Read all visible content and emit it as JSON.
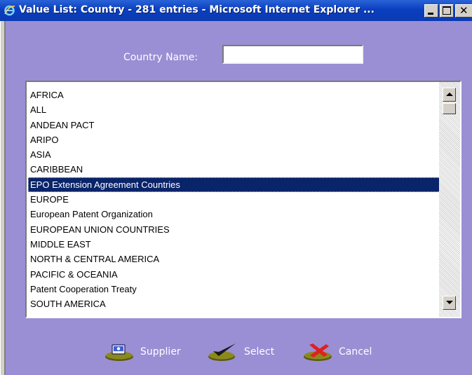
{
  "window": {
    "title": "Value List: Country - 281 entries - Microsoft Internet Explorer ...",
    "icon": "ie-icon",
    "controls": [
      "minimize-icon",
      "maximize-icon",
      "close-icon"
    ],
    "close_glyph": "✕"
  },
  "search": {
    "label": "Country Name:",
    "value": ""
  },
  "list": {
    "selected_index": 6,
    "items": [
      "AFRICA",
      "ALL",
      "ANDEAN PACT",
      "ARIPO",
      "ASIA",
      "CARIBBEAN",
      "EPO Extension Agreement Countries",
      "EUROPE",
      "European Patent Organization",
      "EUROPEAN UNION COUNTRIES",
      "MIDDLE EAST",
      "NORTH & CENTRAL AMERICA",
      "PACIFIC & OCEANIA",
      "Patent Cooperation Treaty",
      "SOUTH AMERICA"
    ]
  },
  "actions": {
    "supplier": {
      "label": "Supplier",
      "icon": "supplier-icon"
    },
    "select": {
      "label": "Select",
      "icon": "checkmark-icon"
    },
    "cancel": {
      "label": "Cancel",
      "icon": "cancel-x-icon"
    }
  },
  "colors": {
    "background": "#9a8fd4",
    "titlebar": "#0a3fbf",
    "selection": "#0a246a"
  }
}
